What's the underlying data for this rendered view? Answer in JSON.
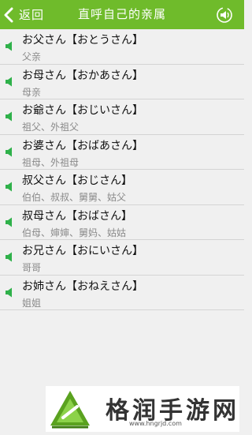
{
  "header": {
    "back_label": "返回",
    "title": "直呼自己的亲属",
    "accent_color": "#6fbb2b"
  },
  "items": [
    {
      "word": "お父さん【おとうさん】",
      "meaning": "父亲"
    },
    {
      "word": "お母さん【おかあさん】",
      "meaning": "母亲"
    },
    {
      "word": "お爺さん【おじいさん】",
      "meaning": "祖父、外祖父"
    },
    {
      "word": "お婆さん【おばあさん】",
      "meaning": "祖母、外祖母"
    },
    {
      "word": "叔父さん【おじさん】",
      "meaning": "伯伯、叔叔、舅舅、姑父"
    },
    {
      "word": "叔母さん【おばさん】",
      "meaning": "伯母、婶婶、舅妈、姑姑"
    },
    {
      "word": "お兄さん【おにいさん】",
      "meaning": "哥哥"
    },
    {
      "word": "お姉さん【おねえさん】",
      "meaning": "姐姐"
    }
  ],
  "icons": {
    "back": "chevron-left-icon",
    "header_action": "speaker-play-icon",
    "row": "speaker-icon"
  },
  "watermark": {
    "name": "格润手游网",
    "url": "www.hngrjd.com"
  }
}
